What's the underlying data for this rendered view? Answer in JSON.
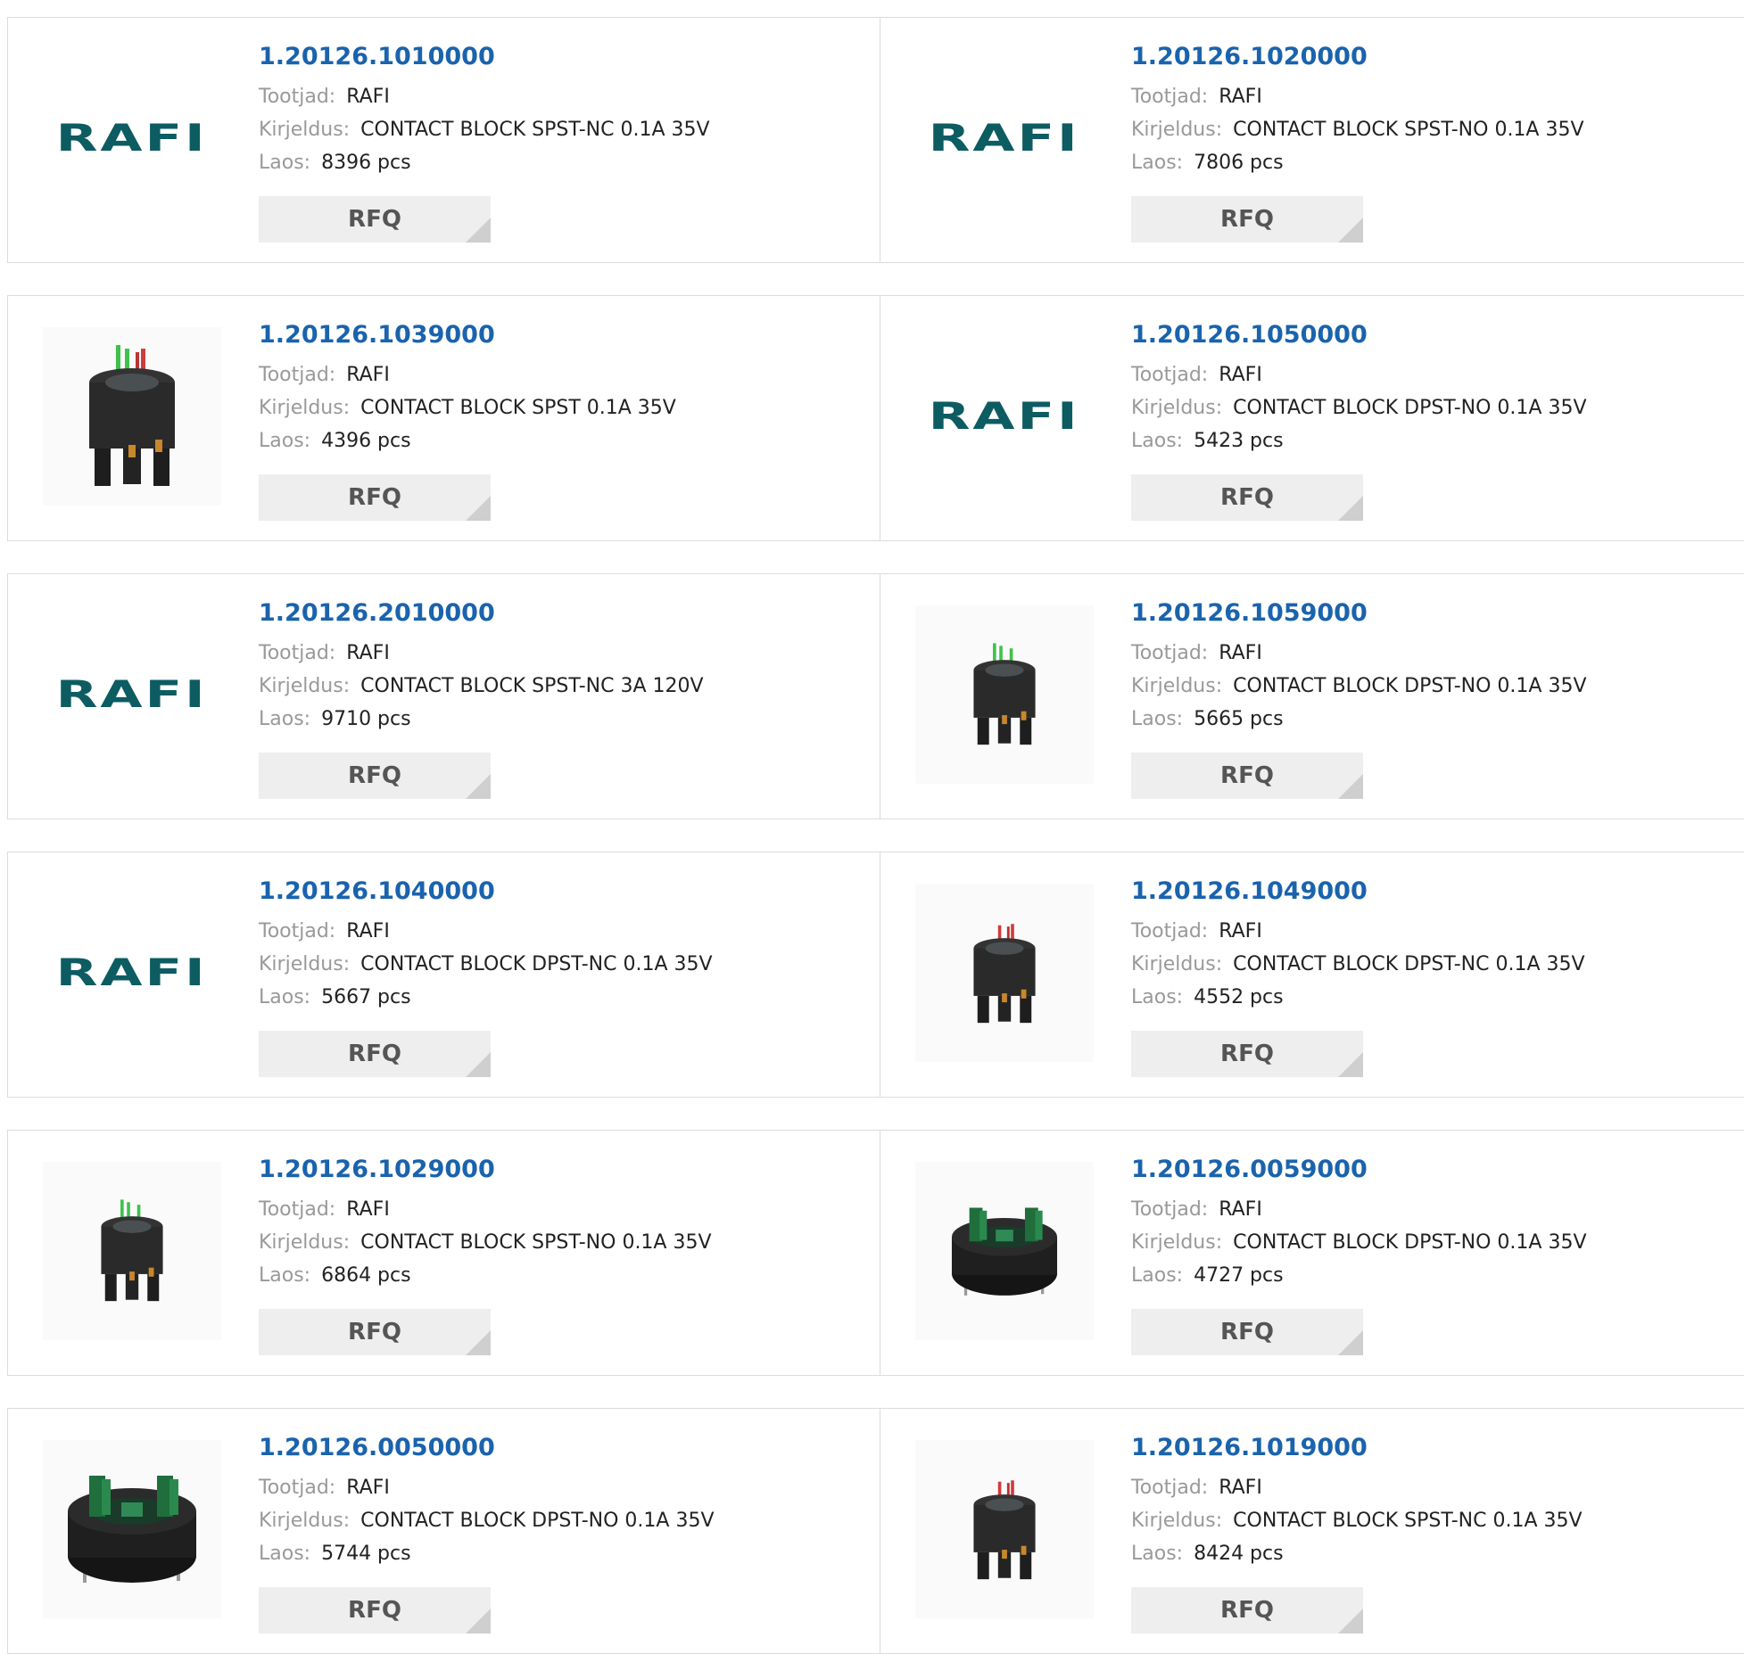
{
  "labels": {
    "manufacturer": "Tootjad:",
    "description": "Kirjeldus:",
    "stock": "Laos:"
  },
  "button_label": "RFQ",
  "brand_color": "#0c5c62",
  "link_color": "#1a63ad",
  "products": [
    {
      "pn": "1.20126.1010000",
      "manufacturer": "RAFI",
      "description": "CONTACT BLOCK SPST-NC 0.1A 35V",
      "stock": "8396 pcs",
      "image": "logo",
      "logo_text": "RAFI"
    },
    {
      "pn": "1.20126.1020000",
      "manufacturer": "RAFI",
      "description": "CONTACT BLOCK SPST-NO 0.1A 35V",
      "stock": "7806 pcs",
      "image": "logo",
      "logo_text": "RAFI"
    },
    {
      "pn": "1.20126.1039000",
      "manufacturer": "RAFI",
      "description": "CONTACT BLOCK SPST 0.1A 35V",
      "stock": "4396 pcs",
      "image": "photo-tall-red-green"
    },
    {
      "pn": "1.20126.1050000",
      "manufacturer": "RAFI",
      "description": "CONTACT BLOCK DPST-NO 0.1A 35V",
      "stock": "5423 pcs",
      "image": "logo",
      "logo_text": "RAFI"
    },
    {
      "pn": "1.20126.2010000",
      "manufacturer": "RAFI",
      "description": "CONTACT BLOCK SPST-NC 3A 120V",
      "stock": "9710 pcs",
      "image": "logo",
      "logo_text": "RAFI"
    },
    {
      "pn": "1.20126.1059000",
      "manufacturer": "RAFI",
      "description": "CONTACT BLOCK DPST-NO 0.1A 35V",
      "stock": "5665 pcs",
      "image": "photo-small-green"
    },
    {
      "pn": "1.20126.1040000",
      "manufacturer": "RAFI",
      "description": "CONTACT BLOCK DPST-NC 0.1A 35V",
      "stock": "5667 pcs",
      "image": "logo",
      "logo_text": "RAFI"
    },
    {
      "pn": "1.20126.1049000",
      "manufacturer": "RAFI",
      "description": "CONTACT BLOCK DPST-NC 0.1A 35V",
      "stock": "4552 pcs",
      "image": "photo-small-red"
    },
    {
      "pn": "1.20126.1029000",
      "manufacturer": "RAFI",
      "description": "CONTACT BLOCK SPST-NO 0.1A 35V",
      "stock": "6864 pcs",
      "image": "photo-small-green"
    },
    {
      "pn": "1.20126.0059000",
      "manufacturer": "RAFI",
      "description": "CONTACT BLOCK DPST-NO 0.1A 35V",
      "stock": "4727 pcs",
      "image": "photo-round-green"
    },
    {
      "pn": "1.20126.0050000",
      "manufacturer": "RAFI",
      "description": "CONTACT BLOCK DPST-NO 0.1A 35V",
      "stock": "5744 pcs",
      "image": "photo-round-green-large"
    },
    {
      "pn": "1.20126.1019000",
      "manufacturer": "RAFI",
      "description": "CONTACT BLOCK SPST-NC 0.1A 35V",
      "stock": "8424 pcs",
      "image": "photo-small-red"
    }
  ]
}
